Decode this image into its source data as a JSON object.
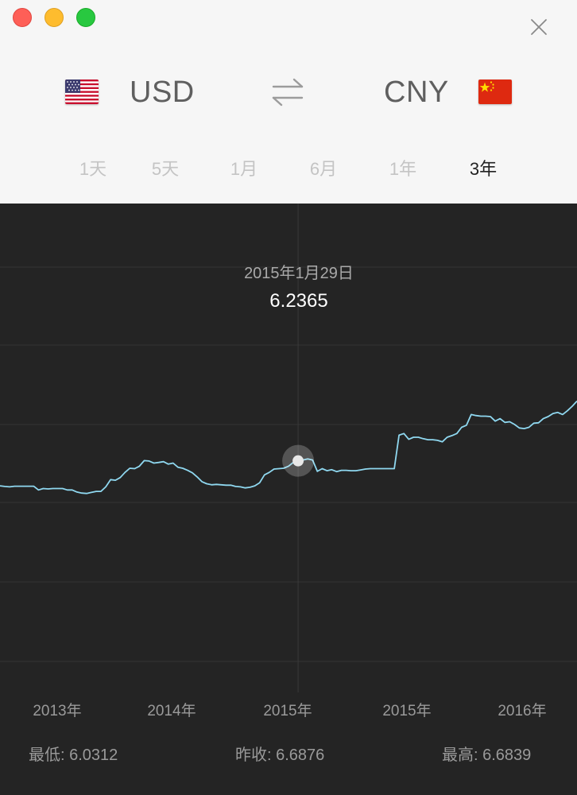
{
  "window": {
    "controls": [
      "close",
      "minimize",
      "zoom"
    ]
  },
  "converter": {
    "from_currency": "USD",
    "to_currency": "CNY",
    "from_flag": "us-flag-icon",
    "to_flag": "cn-flag-icon"
  },
  "ranges": {
    "tabs": [
      "1天",
      "5天",
      "1月",
      "6月",
      "1年",
      "3年"
    ],
    "active": "3年"
  },
  "tooltip": {
    "date": "2015年1月29日",
    "value": "6.2365"
  },
  "stats": {
    "low": "最低: 6.0312",
    "prev_close": "昨收: 6.6876",
    "high": "最高: 6.6839"
  },
  "colors": {
    "line": "#8fd8f0",
    "background": "#242424",
    "header": "#f6f6f6",
    "grid": "#333333"
  },
  "chart_data": {
    "type": "line",
    "x_tick_labels": [
      "2013年",
      "2014年",
      "2015年",
      "2015年",
      "2016年"
    ],
    "series": [
      {
        "values": [
          6.115,
          6.112,
          6.11,
          6.113,
          6.113,
          6.113,
          6.113,
          6.113,
          6.095,
          6.102,
          6.1,
          6.102,
          6.102,
          6.102,
          6.095,
          6.095,
          6.085,
          6.08,
          6.078,
          6.083,
          6.088,
          6.088,
          6.11,
          6.145,
          6.142,
          6.155,
          6.18,
          6.2,
          6.198,
          6.21,
          6.237,
          6.235,
          6.225,
          6.228,
          6.232,
          6.22,
          6.225,
          6.205,
          6.2,
          6.19,
          6.178,
          6.158,
          6.135,
          6.125,
          6.12,
          6.122,
          6.12,
          6.118,
          6.118,
          6.112,
          6.11,
          6.105,
          6.108,
          6.115,
          6.13,
          6.168,
          6.18,
          6.196,
          6.198,
          6.2,
          6.21,
          6.228,
          6.236,
          6.24,
          6.245,
          6.24,
          6.185,
          6.198,
          6.188,
          6.193,
          6.184,
          6.19,
          6.19,
          6.188,
          6.188,
          6.192,
          6.196,
          6.198,
          6.198,
          6.198,
          6.198,
          6.198,
          6.198,
          6.36,
          6.368,
          6.34,
          6.35,
          6.35,
          6.343,
          6.338,
          6.338,
          6.335,
          6.328,
          6.35,
          6.358,
          6.368,
          6.398,
          6.408,
          6.46,
          6.455,
          6.452,
          6.452,
          6.45,
          6.428,
          6.44,
          6.422,
          6.425,
          6.412,
          6.395,
          6.392,
          6.398,
          6.418,
          6.42,
          6.44,
          6.45,
          6.465,
          6.47,
          6.46,
          6.478,
          6.5,
          6.525
        ],
        "ymin": 6.0312,
        "ymax": 6.6839
      }
    ],
    "highlight_index": 62
  }
}
